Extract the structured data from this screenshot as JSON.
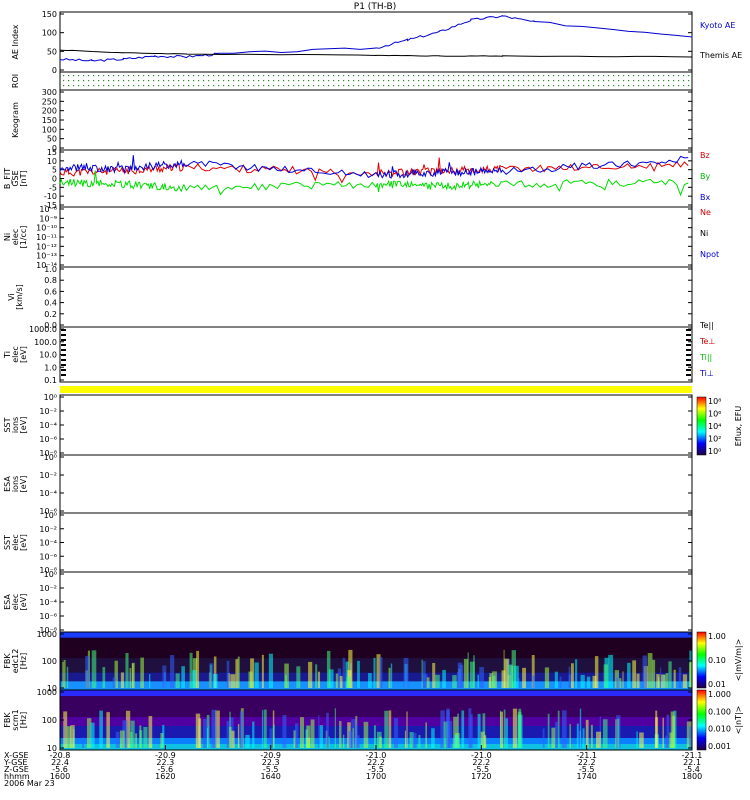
{
  "title": "P1  (TH-B)",
  "panels": [
    {
      "id": "ae",
      "ylabel": [
        "AE Index"
      ],
      "ticks": [
        "150",
        "100",
        "50",
        "0"
      ],
      "legend": [
        {
          "text": "Kyoto AE",
          "color": "#0000cc"
        },
        {
          "text": "Themis AE",
          "color": "#000000"
        }
      ]
    },
    {
      "id": "roi",
      "ylabel": [
        "ROI"
      ],
      "ticks": [],
      "legend": []
    },
    {
      "id": "keogram",
      "ylabel": [
        "Keogram"
      ],
      "ticks": [
        "300",
        "250",
        "200",
        "150",
        "100",
        "50",
        "0"
      ],
      "legend": []
    },
    {
      "id": "bfield",
      "ylabel": [
        "B_FIT",
        "GSE",
        "[nT]"
      ],
      "ticks": [
        "15",
        "10",
        "5",
        "0",
        "-5",
        "-10",
        "-15"
      ],
      "legend": [
        {
          "text": "Bz",
          "color": "#cc0000"
        },
        {
          "text": "By",
          "color": "#00bb00"
        },
        {
          "text": "Bx",
          "color": "#0000cc"
        }
      ]
    },
    {
      "id": "ni",
      "ylabel": [
        "Ni",
        "elec",
        "[1/cc]"
      ],
      "ticks": [
        "10^-8",
        "10^-9",
        "10^-10",
        "10^-11",
        "10^-12",
        "10^-13",
        "10^-14"
      ],
      "legend": [
        {
          "text": "Ne",
          "color": "#cc0000"
        },
        {
          "text": "Ni",
          "color": "#000000"
        },
        {
          "text": "Npot",
          "color": "#0000cc"
        }
      ]
    },
    {
      "id": "vi",
      "ylabel": [
        "Vi",
        "[km/s]"
      ],
      "ticks": [
        "1.0",
        "0.8",
        "0.6",
        "0.4",
        "0.2",
        "0.0"
      ],
      "legend": []
    },
    {
      "id": "ti",
      "ylabel": [
        "Ti",
        "elec",
        "[eV]"
      ],
      "ticks": [
        "1000.0",
        "100.0",
        "10.0",
        "1.0",
        "0.1"
      ],
      "legend": [
        {
          "text": "Te||",
          "color": "#000000"
        },
        {
          "text": "Te⊥",
          "color": "#cc0000"
        },
        {
          "text": "Ti||",
          "color": "#00bb00"
        },
        {
          "text": "Ti⊥",
          "color": "#0000cc"
        }
      ]
    },
    {
      "id": "sst_ion",
      "ylabel": [
        "SST",
        "ions",
        "[eV]"
      ],
      "ticks": [
        "10^0",
        "10^-2",
        "10^-4",
        "10^-6",
        "10^-8"
      ],
      "legend": []
    },
    {
      "id": "esa_ion",
      "ylabel": [
        "ESA",
        "ions",
        "[eV]"
      ],
      "ticks": [
        "10^0",
        "10^-2",
        "10^-4",
        "10^-6"
      ],
      "legend": []
    },
    {
      "id": "sst_elec",
      "ylabel": [
        "SST",
        "elec",
        "[eV]"
      ],
      "ticks": [
        "10^0",
        "10^-2",
        "10^-4",
        "10^-6",
        "10^-8"
      ],
      "legend": []
    },
    {
      "id": "esa_elec",
      "ylabel": [
        "ESA",
        "elec",
        "[eV]"
      ],
      "ticks": [
        "10^0",
        "10^-2",
        "10^-4",
        "10^-6",
        "10^-8"
      ],
      "legend": []
    },
    {
      "id": "fbk_e",
      "ylabel": [
        "FBK",
        "edc12",
        "[Hz]"
      ],
      "ticks": [
        "1000",
        "100",
        "10"
      ],
      "legend": []
    },
    {
      "id": "fbk_b",
      "ylabel": [
        "FBK",
        "scm1",
        "[Hz]"
      ],
      "ticks": [
        "1000",
        "100",
        "10"
      ],
      "legend": []
    }
  ],
  "colorbars": [
    {
      "id": "eflux",
      "label": "Eflux, EFU",
      "ticks": [
        "10^8",
        "10^6",
        "10^4",
        "10^2",
        "10^0"
      ]
    },
    {
      "id": "fbk_e",
      "label": "<|mV/m|>",
      "ticks": [
        "1.00",
        "0.10",
        "0.01"
      ]
    },
    {
      "id": "fbk_b",
      "label": "<|nT|>",
      "ticks": [
        "1.000",
        "0.100",
        "0.010",
        "0.001"
      ]
    }
  ],
  "xaxis": {
    "row_labels": [
      "X-GSE",
      "Y-GSE",
      "Z-GSE",
      "hhmm",
      "2006 Mar 23"
    ],
    "columns": [
      [
        "-20.8",
        "22.4",
        "-5.6",
        "1600"
      ],
      [
        "-20.9",
        "22.3",
        "-5.6",
        "1620"
      ],
      [
        "-20.9",
        "22.3",
        "-5.5",
        "1640"
      ],
      [
        "-21.0",
        "22.2",
        "-5.5",
        "1700"
      ],
      [
        "-21.0",
        "22.2",
        "-5.5",
        "1720"
      ],
      [
        "-21.1",
        "22.2",
        "-5.5",
        "1740"
      ],
      [
        "-21.1",
        "22.1",
        "-5.4",
        "1800"
      ]
    ]
  },
  "chart_data": {
    "type": "line",
    "title": "P1  (TH-B)",
    "x_range": [
      "1600",
      "1800"
    ],
    "series": [
      {
        "name": "Kyoto AE",
        "panel": "ae",
        "x": [
          1600,
          1610,
          1620,
          1630,
          1640,
          1650,
          1700,
          1710,
          1720,
          1730,
          1740,
          1750,
          1800
        ],
        "values": [
          32,
          28,
          32,
          40,
          38,
          45,
          60,
          80,
          100,
          130,
          140,
          125,
          90
        ]
      },
      {
        "name": "Themis AE",
        "panel": "ae",
        "x": [
          1600,
          1620,
          1640,
          1700,
          1720,
          1740,
          1800
        ],
        "values": [
          55,
          48,
          45,
          42,
          40,
          40,
          38
        ]
      },
      {
        "name": "Bz",
        "panel": "bfield",
        "x": [
          1600,
          1620,
          1640,
          1700,
          1720,
          1740,
          1800
        ],
        "values": [
          3,
          4,
          6,
          3,
          4,
          5,
          7
        ]
      },
      {
        "name": "By",
        "panel": "bfield",
        "x": [
          1600,
          1620,
          1640,
          1700,
          1720,
          1740,
          1800
        ],
        "values": [
          -2,
          -3,
          -5,
          -3,
          -4,
          -3,
          -2
        ]
      },
      {
        "name": "Bx",
        "panel": "bfield",
        "x": [
          1600,
          1620,
          1640,
          1700,
          1720,
          1740,
          1800
        ],
        "values": [
          6,
          5,
          8,
          2,
          3,
          4,
          10
        ]
      }
    ],
    "ylim_ae": [
      0,
      150
    ],
    "ylim_bfield": [
      -15,
      15
    ]
  }
}
